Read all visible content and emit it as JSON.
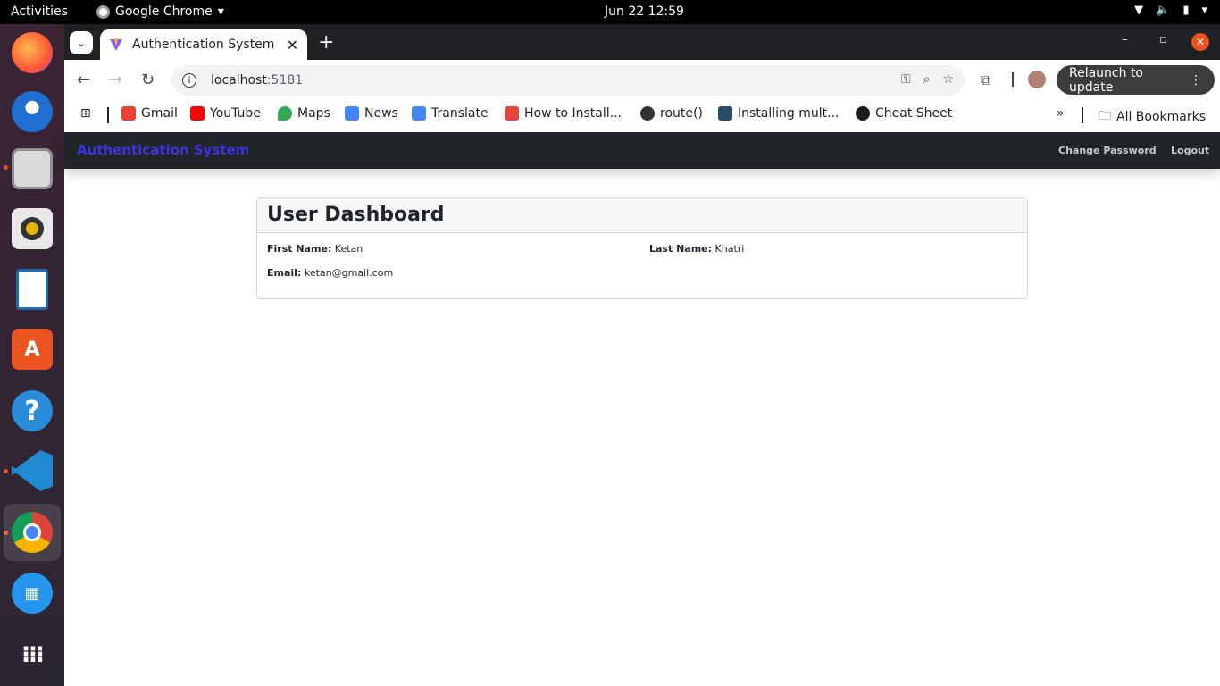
{
  "topbar": {
    "activities": "Activities",
    "app_name": "Google Chrome",
    "clock": "Jun 22  12:59"
  },
  "dock": {
    "items": [
      "firefox-icon",
      "thunderbird-icon",
      "files-icon",
      "rhythmbox-icon",
      "writer-icon",
      "app-center-icon",
      "help-icon",
      "vscode-icon",
      "chrome-icon",
      "docker-icon",
      "show-apps-icon"
    ]
  },
  "browser": {
    "tab_title": "Authentication System",
    "url_host": "localhost",
    "url_port": ":5181",
    "relaunch_label": "Relaunch to update",
    "bookmarks": [
      {
        "label": "Gmail",
        "color": "#ea4335"
      },
      {
        "label": "YouTube",
        "color": "#ff0000"
      },
      {
        "label": "Maps",
        "color": "#34a853"
      },
      {
        "label": "News",
        "color": "#4285f4"
      },
      {
        "label": "Translate",
        "color": "#4285f4"
      },
      {
        "label": "How to Install...",
        "color": "#e8453c"
      },
      {
        "label": "route()",
        "color": "#333333"
      },
      {
        "label": "Installing mult...",
        "color": "#2a4d69"
      },
      {
        "label": "Cheat Sheet",
        "color": "#1a1a1a"
      }
    ],
    "all_bookmarks": "All Bookmarks"
  },
  "app": {
    "brand": "Authentication System",
    "brand_color": "#3b33e0",
    "nav": {
      "change_password": "Change Password",
      "logout": "Logout"
    }
  },
  "dashboard": {
    "title": "User Dashboard",
    "first_name_label": "First Name:",
    "first_name": "Ketan",
    "last_name_label": "Last Name:",
    "last_name": "Khatri",
    "email_label": "Email:",
    "email": "ketan@gmail.com"
  }
}
